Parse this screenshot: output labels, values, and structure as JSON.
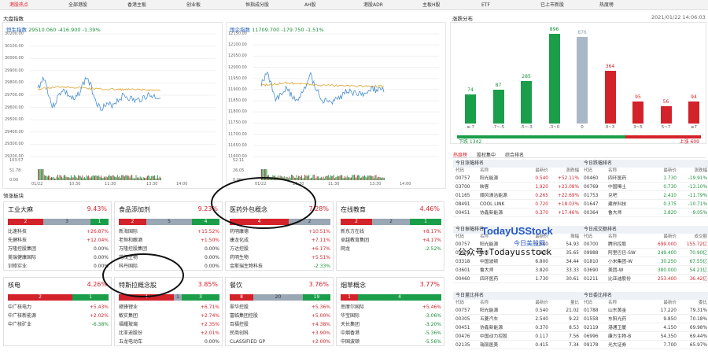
{
  "tabs": [
    "港股热点",
    "全部港股",
    "香港主板",
    "创业板",
    "恒指成分股",
    "AH股",
    "港股ADR",
    "主板H股",
    "ETF",
    "已上市新股",
    "热度榜"
  ],
  "sections": {
    "index_title": "大盘指数",
    "sector_title": "领涨板块",
    "dist_title": "涨跌分布",
    "timestamp": "2021/01/22 14:06:03"
  },
  "index_charts": [
    {
      "name": "恒生指数",
      "value": "29510.060",
      "change": "-416.900",
      "pct": "-1.39%",
      "yticks": [
        "30200.00",
        "30100.00",
        "30000.00",
        "29900.00",
        "29800.00",
        "29700.00",
        "29600.00",
        "29500.00",
        "29400.00",
        "29300.00",
        "29200.00"
      ],
      "vol_ticks": [
        "103.57",
        "51.78",
        "0.00"
      ],
      "xticks": [
        "01/22",
        "10:30",
        "11:30",
        "13:30",
        "14:00"
      ]
    },
    {
      "name": "国企指数",
      "value": "11709.700",
      "change": "-179.750",
      "pct": "-1.51%",
      "yticks": [
        "12150.00",
        "12100.00",
        "12050.00",
        "12000.00",
        "11950.00",
        "11900.00",
        "11850.00",
        "11800.00",
        "11750.00",
        "11700.00",
        "11650.00",
        "11600.00"
      ],
      "vol_ticks": [
        "52.11",
        "26.05",
        "0.00"
      ],
      "xticks": [
        "01/22",
        "10:30",
        "11:30",
        "13:30",
        "14:00"
      ]
    }
  ],
  "sectors": [
    {
      "title": "工业大麻",
      "pct": "9.43%",
      "bar": [
        {
          "v": "2",
          "c": "r",
          "w": 45
        },
        {
          "v": "3",
          "c": "g",
          "w": 60
        },
        {
          "v": "1",
          "c": "gr",
          "w": 23
        }
      ],
      "stocks": [
        [
          "比速科技",
          "+26.87%",
          "up"
        ],
        [
          "先健科技",
          "+12.04%",
          "up"
        ],
        [
          "万隆控股集团",
          "0.00%",
          ""
        ],
        [
          "美瑞健康国际",
          "0.00%",
          ""
        ],
        [
          "训修实业",
          "0.00%",
          ""
        ]
      ]
    },
    {
      "title": "食品添加剂",
      "pct": "9.23%",
      "bar": [
        {
          "v": "2",
          "c": "r",
          "w": 35
        },
        {
          "v": "5",
          "c": "g",
          "w": 58
        },
        {
          "v": "4",
          "c": "gr",
          "w": 35
        }
      ],
      "stocks": [
        [
          "新海国际",
          "+15.52%",
          "up"
        ],
        [
          "老恒和酿酒",
          "+1.50%",
          "up"
        ],
        [
          "万隆控股集团",
          "0.00%",
          ""
        ],
        [
          "常茂生物",
          "0.00%",
          ""
        ],
        [
          "科丹国际",
          "0.00%",
          ""
        ]
      ]
    },
    {
      "title": "医药外包概念",
      "pct": "7.28%",
      "bar": [
        {
          "v": "4",
          "c": "r",
          "w": 75
        },
        {
          "v": "2",
          "c": "g",
          "w": 53
        }
      ],
      "stocks": [
        [
          "药明康德",
          "+10.51%",
          "up"
        ],
        [
          "康龙化成",
          "+7.11%",
          "up"
        ],
        [
          "方达控股",
          "+6.17%",
          "up"
        ],
        [
          "药明生物",
          "+5.51%",
          "up"
        ],
        [
          "金斯瑞生物科技",
          "-2.33%",
          "dn"
        ]
      ]
    },
    {
      "title": "在线教育",
      "pct": "4.46%",
      "bar": [
        {
          "v": "2",
          "c": "r",
          "w": 40
        },
        {
          "v": "2",
          "c": "g",
          "w": 48
        },
        {
          "v": "1",
          "c": "gr",
          "w": 40
        }
      ],
      "stocks": [
        [
          "新东方在线",
          "+8.17%",
          "up"
        ],
        [
          "卓越教育集团",
          "+4.17%",
          "up"
        ],
        [
          "网龙",
          "-2.52%",
          "dn"
        ],
        [
          "",
          "",
          ""
        ],
        [
          "",
          "",
          ""
        ]
      ]
    },
    {
      "title": "核电",
      "pct": "4.26%",
      "bar": [
        {
          "v": "2",
          "c": "r",
          "w": 82
        },
        {
          "v": "1",
          "c": "gr",
          "w": 46
        }
      ],
      "stocks": [
        [
          "中广核电力",
          "+5.43%",
          "up"
        ],
        [
          "中广核新能源",
          "+2.02%",
          "up"
        ],
        [
          "中广核矿业",
          "-6.38%",
          "dn"
        ],
        [
          "",
          "",
          ""
        ],
        [
          "",
          "",
          ""
        ]
      ]
    },
    {
      "title": "特斯拉概念股",
      "pct": "3.85%",
      "bar": [
        {
          "v": "4",
          "c": "r",
          "w": 70
        },
        {
          "v": "1",
          "c": "g",
          "w": 10
        },
        {
          "v": "3",
          "c": "gr",
          "w": 48
        }
      ],
      "stocks": [
        [
          "赣锋锂业",
          "+6.71%",
          "up"
        ],
        [
          "敏实集团",
          "+2.74%",
          "up"
        ],
        [
          "福耀玻璃",
          "+2.35%",
          "up"
        ],
        [
          "比亚迪股份",
          "+2.01%",
          "up"
        ],
        [
          "五龙电动车",
          "0.00%",
          ""
        ]
      ]
    },
    {
      "title": "餐饮",
      "pct": "3.76%",
      "bar": [
        {
          "v": "8",
          "c": "r",
          "w": 30
        },
        {
          "v": "20",
          "c": "g",
          "w": 63
        },
        {
          "v": "19",
          "c": "gr",
          "w": 35
        }
      ],
      "stocks": [
        [
          "翠华控股",
          "+5.36%",
          "up"
        ],
        [
          "富临集团控股",
          "+5.00%",
          "up"
        ],
        [
          "百福控股",
          "+4.38%",
          "up"
        ],
        [
          "民商创科",
          "+3.90%",
          "up"
        ],
        [
          "CLASSIFIED GP",
          "+2.00%",
          "up"
        ]
      ]
    },
    {
      "title": "烟草概念",
      "pct": "3.77%",
      "bar": [
        {
          "v": "1",
          "c": "r",
          "w": 22
        },
        {
          "v": "4",
          "c": "gr",
          "w": 106
        }
      ],
      "stocks": [
        [
          "思摩尔国际",
          "+5.46%",
          "up"
        ],
        [
          "华宝国际",
          "-3.06%",
          "dn"
        ],
        [
          "天长集团",
          "-3.20%",
          "dn"
        ],
        [
          "中烟香港",
          "-5.36%",
          "dn"
        ],
        [
          "中国波顿",
          "-5.56%",
          "dn"
        ]
      ]
    }
  ],
  "distribution": {
    "bars": [
      {
        "label": "≤-7",
        "value": "74",
        "h": 37
      },
      {
        "label": "-7~-5",
        "value": "87",
        "h": 43
      },
      {
        "label": "-5~-3",
        "value": "285",
        "h": 54
      },
      {
        "label": "-3~0",
        "value": "896",
        "h": 114
      },
      {
        "label": "0",
        "value": "876",
        "h": 110
      },
      {
        "label": "0~3",
        "value": "364",
        "h": 67
      },
      {
        "label": "3~5",
        "value": "95",
        "h": 28
      },
      {
        "label": "5~7",
        "value": "56",
        "h": 22
      },
      {
        "label": "≥7",
        "value": "94",
        "h": 28
      }
    ],
    "down_label": "下跌 1342",
    "up_label": "上涨 609",
    "down_frac": 0.69
  },
  "board_tabs": [
    "热度榜",
    "股权集中",
    "综合排名"
  ],
  "tables": [
    {
      "title": "今日涨幅排名",
      "head": [
        "代码",
        "名称",
        "最新价",
        "涨跌幅"
      ],
      "rows": [
        [
          "00757",
          "阳光能源",
          "0.540",
          "+52.11%",
          "up"
        ],
        [
          "03700",
          "映客",
          "1.920",
          "+23.08%",
          "up"
        ],
        [
          "01165",
          "顺风清洁能源",
          "0.265",
          "+22.69%",
          "up"
        ],
        [
          "08491",
          "COOL LINK",
          "0.720",
          "+18.03%",
          "up"
        ],
        [
          "00451",
          "协鑫新能源",
          "0.370",
          "+17.46%",
          "up"
        ]
      ]
    },
    {
      "title": "今日跌幅排名",
      "head": [
        "代码",
        "名称",
        "最新价",
        "涨跌幅"
      ],
      "rows": [
        [
          "00460",
          "四环医药",
          "1.730",
          "-19.91%",
          "dn"
        ],
        [
          "00769",
          "中国稀土",
          "0.730",
          "-13.10%",
          "dn"
        ],
        [
          "01753",
          "兑吧",
          "2.410",
          "-11.79%",
          "dn"
        ],
        [
          "01647",
          "建岸科技",
          "0.375",
          "-10.71%",
          "dn"
        ],
        [
          "00364",
          "鲁大师",
          "3.820",
          "-9.05%",
          "dn"
        ]
      ]
    },
    {
      "title": "今日振幅排名",
      "head": [
        "代码",
        "名称",
        "最新价",
        "振幅"
      ],
      "rows": [
        [
          "00757",
          "阳光能源",
          "0.540",
          "54.93",
          ""
        ],
        [
          "03700",
          "映客",
          "1.920",
          "35.65",
          ""
        ],
        [
          "03318",
          "中国波顿",
          "6.800",
          "34.44",
          ""
        ],
        [
          "03601",
          "鲁大师",
          "3.820",
          "33.33",
          ""
        ],
        [
          "00460",
          "四环医药",
          "1.730",
          "30.61",
          ""
        ]
      ]
    },
    {
      "title": "今日成交额排名",
      "head": [
        "代码",
        "名称",
        "最新价",
        "成交额"
      ],
      "rows": [
        [
          "00700",
          "腾讯控股",
          "699.000",
          "155.72亿",
          "up"
        ],
        [
          "09988",
          "阿里巴巴-SW",
          "249.400",
          "70.90亿",
          "dn"
        ],
        [
          "01810",
          "小米集团-W",
          "30.250",
          "67.55亿",
          "dn"
        ],
        [
          "03690",
          "美团-W",
          "380.000",
          "54.21亿",
          "dn"
        ],
        [
          "01211",
          "比亚迪股份",
          "253.400",
          "36.42亿",
          "up"
        ]
      ]
    },
    {
      "title": "今日量比排名",
      "head": [
        "代码",
        "名称",
        "最新价",
        "量比"
      ],
      "rows": [
        [
          "00757",
          "阳光能源",
          "0.540",
          "21.02",
          ""
        ],
        [
          "00305",
          "五菱汽车",
          "2.540",
          "9.22",
          ""
        ],
        [
          "00451",
          "协鑫新能源",
          "0.370",
          "8.53",
          ""
        ],
        [
          "00476",
          "中国动力控股",
          "0.117",
          "7.56",
          ""
        ],
        [
          "02135",
          "瑞丽医美",
          "0.415",
          "7.34",
          ""
        ]
      ]
    },
    {
      "title": "今日委比排名",
      "head": [
        "代码",
        "名称",
        "最新价",
        "委比"
      ],
      "rows": [
        [
          "01788",
          "山东黄金",
          "17.220",
          "79.31%",
          ""
        ],
        [
          "01558",
          "东阳光药",
          "9.850",
          "70.18%",
          ""
        ],
        [
          "02119",
          "港通卫厦",
          "4.150",
          "69.98%",
          ""
        ],
        [
          "06996",
          "康方生物-B",
          "54.350",
          "69.44%",
          ""
        ],
        [
          "09178",
          "光大证券",
          "7.700",
          "65.97%",
          ""
        ]
      ]
    }
  ],
  "watermarks": {
    "brand1": "TodayUSStock",
    "brand2": "今日美股网",
    "brand3": "公众号:Todayusstock"
  }
}
